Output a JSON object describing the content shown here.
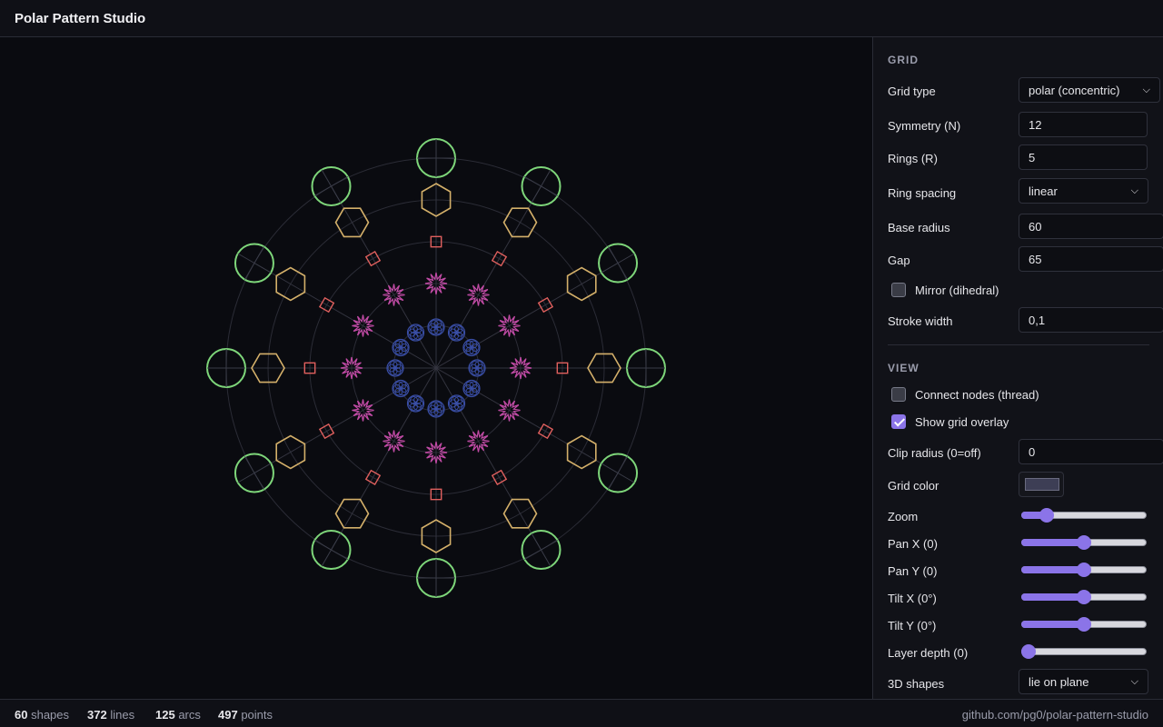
{
  "app": {
    "title": "Polar Pattern Studio"
  },
  "grid_section": {
    "title": "GRID",
    "grid_type": {
      "label": "Grid type",
      "value": "polar (concentric)"
    },
    "symmetry": {
      "label": "Symmetry (N)",
      "value": "12"
    },
    "rings": {
      "label": "Rings (R)",
      "value": "5"
    },
    "ring_spacing": {
      "label": "Ring spacing",
      "value": "linear"
    },
    "base_radius": {
      "label": "Base radius",
      "value": "60"
    },
    "gap": {
      "label": "Gap",
      "value": "65"
    },
    "mirror": {
      "label": "Mirror (dihedral)",
      "checked": false
    },
    "stroke_width": {
      "label": "Stroke width",
      "value": "0,1"
    }
  },
  "view_section": {
    "title": "VIEW",
    "connect_nodes": {
      "label": "Connect nodes (thread)",
      "checked": false
    },
    "show_grid": {
      "label": "Show grid overlay",
      "checked": true
    },
    "clip_radius": {
      "label": "Clip radius (0=off)",
      "value": "0"
    },
    "grid_color": {
      "label": "Grid color",
      "value": "#3d3e55"
    },
    "zoom": {
      "label": "Zoom",
      "level": 0.16
    },
    "pan_x": {
      "label": "Pan X (0)",
      "level": 0.5
    },
    "pan_y": {
      "label": "Pan Y (0)",
      "level": 0.5
    },
    "tilt_x": {
      "label": "Tilt X (0°)",
      "level": 0.5
    },
    "tilt_y": {
      "label": "Tilt Y (0°)",
      "level": 0.5
    },
    "layer_depth": {
      "label": "Layer depth (0)",
      "level": 0.0
    },
    "shapes_3d": {
      "label": "3D shapes",
      "value": "lie on plane"
    }
  },
  "status": {
    "shapes": {
      "count": "60",
      "unit": "shapes"
    },
    "lines": {
      "count": "372",
      "unit": "lines"
    },
    "arcs": {
      "count": "125",
      "unit": "arcs"
    },
    "points": {
      "count": "497",
      "unit": "points"
    },
    "repo": "github.com/pg0/polar-pattern-studio"
  },
  "colors": {
    "accent": "#8b74e8",
    "ring5_circles": "#7ed67a",
    "ring4_hexagons": "#d4b06a",
    "ring3_diamonds": "#e0605e",
    "ring2_stars": "#c24ba6",
    "ring1_rosettes": "#3a4fa8"
  },
  "icons": {
    "select_chevron": "chevron-down-icon",
    "checkbox_check": "check-icon"
  }
}
